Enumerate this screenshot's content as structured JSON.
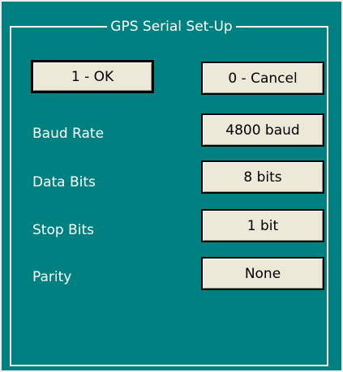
{
  "dialog": {
    "group_title": "GPS Serial Set-Up"
  },
  "buttons": {
    "ok_label": "1 - OK",
    "cancel_label": "0 - Cancel"
  },
  "settings": [
    {
      "label": "Baud Rate",
      "value": "4800 baud"
    },
    {
      "label": "Data Bits",
      "value": "8 bits"
    },
    {
      "label": "Stop Bits",
      "value": "1 bit"
    },
    {
      "label": "Parity",
      "value": "None"
    }
  ]
}
